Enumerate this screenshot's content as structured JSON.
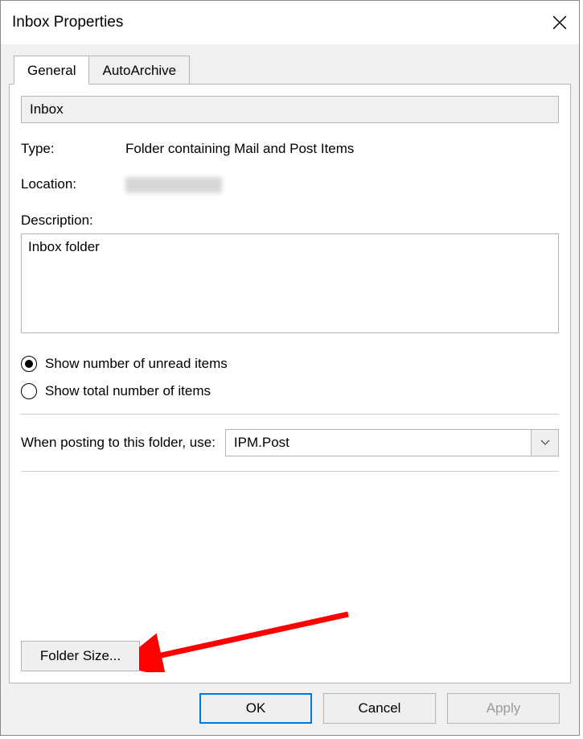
{
  "dialog": {
    "title": "Inbox Properties"
  },
  "tabs": {
    "general": "General",
    "autoarchive": "AutoArchive"
  },
  "general": {
    "folder_name": "Inbox",
    "type_label": "Type:",
    "type_value": "Folder containing Mail and Post Items",
    "location_label": "Location:",
    "description_label": "Description:",
    "description_value": "Inbox folder",
    "radio_unread": "Show number of unread items",
    "radio_total": "Show total number of items",
    "posting_label": "When posting to this folder, use:",
    "posting_value": "IPM.Post",
    "folder_size_btn": "Folder Size..."
  },
  "buttons": {
    "ok": "OK",
    "cancel": "Cancel",
    "apply": "Apply"
  }
}
